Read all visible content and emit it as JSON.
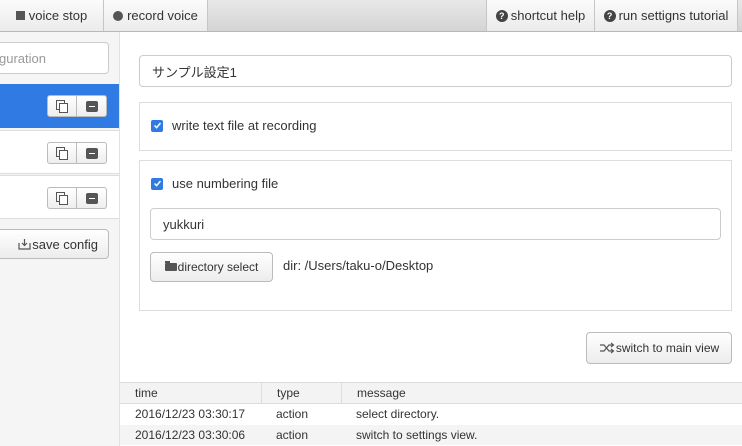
{
  "toolbar": {
    "voice_stop": "voice stop",
    "record_voice": "record voice",
    "shortcut_help": "shortcut help",
    "run_tutorial": "run settigns tutorial"
  },
  "sidebar": {
    "filter_placeholder": "guration",
    "save_config": "save config",
    "items": [
      {
        "label": "",
        "active": true
      },
      {
        "label": "",
        "active": false
      },
      {
        "label": "",
        "active": false
      }
    ]
  },
  "settings": {
    "name_value": "サンプル設定1",
    "write_text_label": "write text file at recording",
    "write_text_checked": true,
    "use_numbering_label": "use numbering file",
    "use_numbering_checked": true,
    "numbering_value": "yukkuri",
    "directory_select_label": "directory select",
    "dir_text": "dir: /Users/taku-o/Desktop",
    "switch_view_label": "switch to main view"
  },
  "log": {
    "columns": [
      "time",
      "type",
      "message"
    ],
    "rows": [
      {
        "time": "2016/12/23 03:30:17",
        "type": "action",
        "message": "select directory."
      },
      {
        "time": "2016/12/23 03:30:06",
        "type": "action",
        "message": "switch to settings view."
      }
    ]
  },
  "colors": {
    "accent": "#2f7be3"
  }
}
